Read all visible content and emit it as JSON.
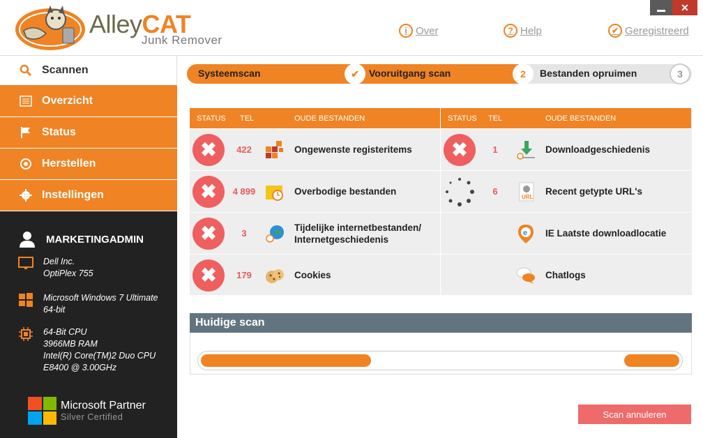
{
  "window": {
    "close_label": "✕"
  },
  "header": {
    "logo_alley": "Alley",
    "logo_cat": "CAT",
    "logo_sub": "Junk Remover",
    "links": [
      {
        "label": "Over",
        "icon": "info-icon"
      },
      {
        "label": "Help",
        "icon": "help-icon"
      },
      {
        "label": "Geregistreerd",
        "icon": "check-icon"
      }
    ]
  },
  "sidebar": {
    "items": [
      {
        "label": "Scannen",
        "icon": "search-icon",
        "active": true
      },
      {
        "label": "Overzicht",
        "icon": "list-icon"
      },
      {
        "label": "Status",
        "icon": "flag-icon"
      },
      {
        "label": "Herstellen",
        "icon": "restore-icon"
      },
      {
        "label": "Instellingen",
        "icon": "gear-icon"
      }
    ],
    "user": "MARKETINGADMIN",
    "info": [
      {
        "icon": "monitor-icon",
        "lines": [
          "Dell Inc.",
          "OptiPlex 755"
        ]
      },
      {
        "icon": "windows-icon",
        "lines": [
          "Microsoft Windows 7 Ultimate",
          "64-bit"
        ]
      },
      {
        "icon": "cpu-icon",
        "lines": [
          "64-Bit CPU",
          "3966MB RAM",
          "Intel(R) Core(TM)2 Duo CPU",
          "E8400  @ 3.00GHz"
        ]
      }
    ],
    "partner_title": "Microsoft Partner",
    "partner_sub": "Silver Certified"
  },
  "steps": {
    "step1": "Systeemscan",
    "step2": "Vooruitgang scan",
    "step3": "Bestanden opruimen",
    "num2": "2",
    "num3": "3",
    "check": "✔"
  },
  "table": {
    "headers": {
      "status": "STATUS",
      "count": "TEL",
      "name": "OUDE BESTANDEN"
    },
    "left": [
      {
        "count": "422",
        "label": "Ongewenste registeritems",
        "icon": "registry-icon"
      },
      {
        "count": "4 899",
        "label": "Overbodige bestanden",
        "icon": "folder-clock-icon"
      },
      {
        "count": "3",
        "label": "Tijdelijke internetbestanden/",
        "label2": "Internetgeschiedenis",
        "icon": "globe-icon"
      },
      {
        "count": "179",
        "label": "Cookies",
        "icon": "cookie-icon"
      }
    ],
    "right": [
      {
        "count": "1",
        "label": "Downloadgeschiedenis",
        "icon": "download-icon",
        "status": "error"
      },
      {
        "count": "6",
        "label": "Recent getypte URL's",
        "icon": "url-icon",
        "status": "scanning"
      },
      {
        "count": "",
        "label": "IE Laatste downloadlocatie",
        "icon": "ie-location-icon",
        "status": "pending"
      },
      {
        "count": "",
        "label": "Chatlogs",
        "icon": "chat-icon",
        "status": "pending"
      }
    ],
    "x_glyph": "✖"
  },
  "current_scan": {
    "title": "Huidige scan",
    "progress_segments": [
      [
        0.0,
        0.355
      ],
      [
        0.885,
        1.0
      ]
    ]
  },
  "cancel_label": "Scan annuleren",
  "colors": {
    "accent": "#f08323",
    "error": "#ef5f5f",
    "dark": "#222222",
    "slate": "#627480"
  }
}
